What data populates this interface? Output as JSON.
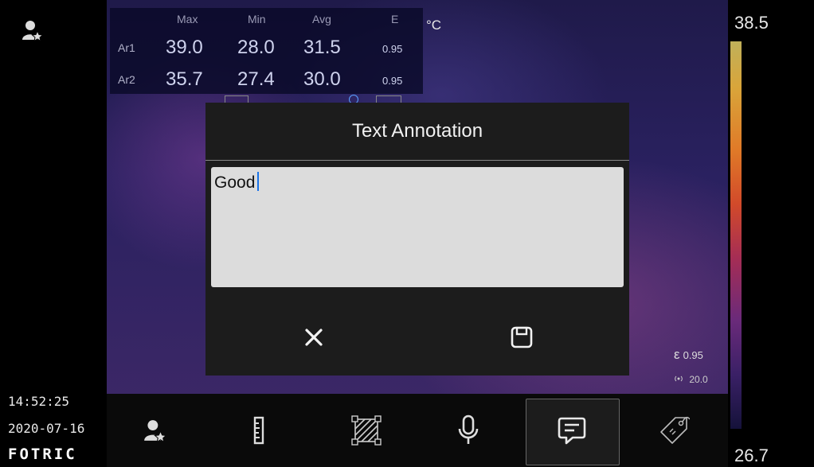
{
  "status": {
    "time": "14:52:25",
    "date": "2020-07-16",
    "brand": "FOTRIC"
  },
  "measurements": {
    "headers": [
      "Max",
      "Min",
      "Avg",
      "E"
    ],
    "unit": "°C",
    "rows": [
      {
        "label": "Ar1",
        "max": "39.0",
        "min": "28.0",
        "avg": "31.5",
        "e": "0.95"
      },
      {
        "label": "Ar2",
        "max": "35.7",
        "min": "27.4",
        "avg": "30.0",
        "e": "0.95"
      }
    ]
  },
  "color_bar": {
    "max": "38.5",
    "min": "26.7"
  },
  "readouts": {
    "emissivity": "0.95",
    "distance": "20.0"
  },
  "dialog": {
    "title": "Text Annotation",
    "text_value": "Good",
    "cancel_icon": "close-icon",
    "save_icon": "save-icon"
  },
  "toolbar": {
    "items": [
      "profile-icon",
      "ruler-icon",
      "area-icon",
      "microphone-icon",
      "text-note-icon",
      "tag-icon"
    ],
    "selected": "text-note-icon"
  },
  "colors": {
    "dialog_bg": "#1c1c1c",
    "textbox_bg": "#dcdcdc",
    "caret": "#1a73e8"
  }
}
